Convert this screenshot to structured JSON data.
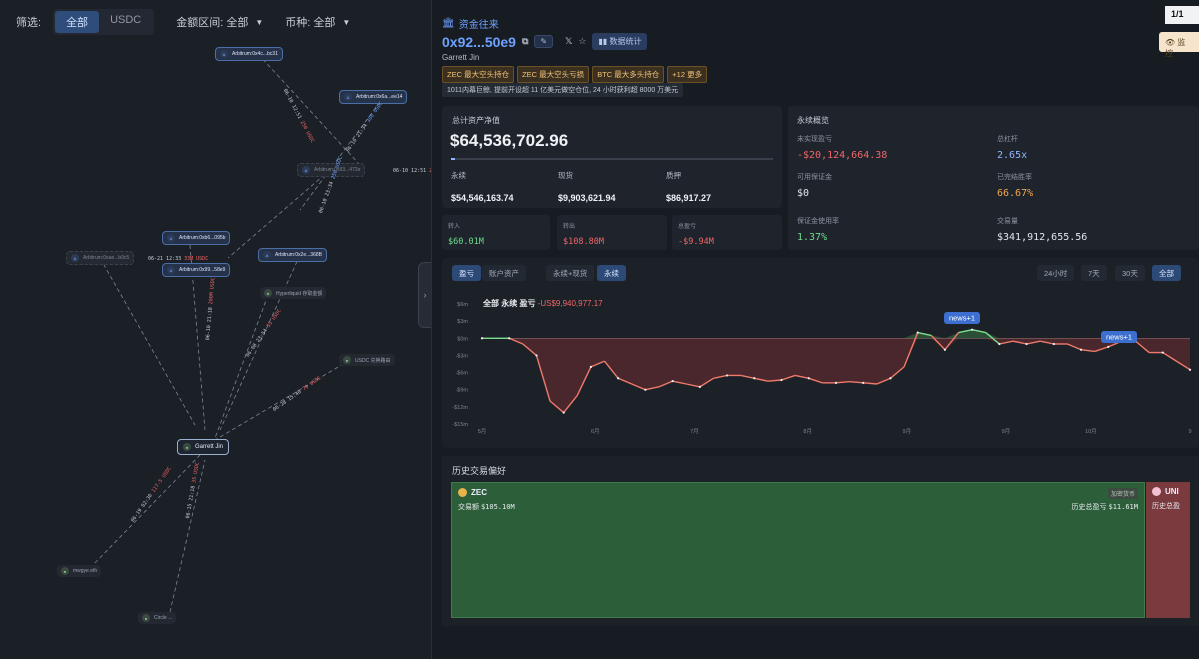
{
  "filters": {
    "label": "筛选:",
    "segments": [
      "全部",
      "USDC"
    ],
    "active_segment": "全部",
    "amount_label": "金额区间: 全部",
    "coin_label": "币种: 全部"
  },
  "graph": {
    "nodes": [
      {
        "id": "n1",
        "label": "Arbitrum:0x4c...bc31",
        "kind": "arb"
      },
      {
        "id": "n2",
        "label": "Arbitrum:0x6a...ee14",
        "kind": "arb"
      },
      {
        "id": "n3",
        "label": "Arbitrum:0x93...472e",
        "kind": "dim"
      },
      {
        "id": "n4",
        "label": "Arbitrum:0xb6...095b",
        "kind": "arb"
      },
      {
        "id": "n5",
        "label": "Arbitrum:0xae...b0c5",
        "kind": "dim"
      },
      {
        "id": "n6",
        "label": "Arbitrum:0x99...58e9",
        "kind": "arb"
      },
      {
        "id": "n7",
        "label": "Arbitrum:0x2e...368B",
        "kind": "arb"
      },
      {
        "id": "n8",
        "label": "Hyperliquid 存取金额",
        "kind": "plain"
      },
      {
        "id": "n9",
        "label": "USDC 兑换路由",
        "kind": "plain"
      },
      {
        "id": "n10",
        "label": "Garrett Jin",
        "kind": "center"
      },
      {
        "id": "n11",
        "label": "mwgye.eth",
        "kind": "plain"
      },
      {
        "id": "n12",
        "label": "Circle ...",
        "kind": "plain"
      }
    ],
    "edges": [
      {
        "date": "06-10 12:51",
        "amount": "250 USDC",
        "color": "#ef6767"
      },
      {
        "date": "06-10 21:34",
        "amount": "300 USDC",
        "color": "#6ea2ff"
      },
      {
        "date": "06-10 12:51",
        "amount": "250 USDC",
        "color": "#ef6767"
      },
      {
        "date": "06-10 23:34",
        "amount": "250 USDC",
        "color": "#6ea2ff"
      },
      {
        "date": "06-21 12:33",
        "amount": "33M USDC",
        "color": "#ef6767"
      },
      {
        "date": "06-10 21:18",
        "amount": "200M USDC",
        "color": "#ef6767"
      },
      {
        "date": "06-08 23:54",
        "amount": "35 USDC",
        "color": "#ef6767"
      },
      {
        "date": "06-28 15:40",
        "amount": "70 USDC",
        "color": "#ef6767"
      },
      {
        "date": "06-19 02:30",
        "amount": "117.5 USDC",
        "color": "#ef6767"
      },
      {
        "date": "06-15 21:18",
        "amount": "35 USDC",
        "color": "#ef6767"
      }
    ]
  },
  "header": {
    "section": "资金往来",
    "address": "0x92...50e9",
    "stats_button": "数据统计",
    "owner": "Garrett Jin",
    "tags": [
      "ZEC 最大空头持仓",
      "ZEC 最大空头亏损",
      "BTC 最大多头持仓",
      "+12 更多"
    ],
    "description": "1011内幕巨鲸, 提前开设超 11 亿美元做空仓位, 24 小时获利超 8000 万美元",
    "pager": "1/1",
    "monitor": "监控"
  },
  "networth": {
    "title": "总计资产净值",
    "value": "$64,536,702.96",
    "items": [
      {
        "label": "永续",
        "value": "$54,546,163.74"
      },
      {
        "label": "现货",
        "value": "$9,903,621.94"
      },
      {
        "label": "质押",
        "value": "$86,917.27"
      }
    ],
    "flows": [
      {
        "label": "转入",
        "value": "$60.01M",
        "tone": "green"
      },
      {
        "label": "转出",
        "value": "$108.80M",
        "tone": "red"
      },
      {
        "label": "总盈亏",
        "value": "-$9.94M",
        "tone": "red"
      }
    ]
  },
  "perp": {
    "title": "永续概览",
    "unrealized_label": "未实现盈亏",
    "unrealized": "-$20,124,664.38",
    "leverage_label": "总杠杆",
    "leverage": "2.65x",
    "margin_label": "可用保证金",
    "margin": "$0",
    "winrate_label": "已完结胜率",
    "winrate": "66.67%",
    "usage_label": "保证金使用率",
    "usage": "1.37%",
    "volume_label": "交易量",
    "volume": "$341,912,655.56"
  },
  "chart": {
    "tabs_left": [
      "盈亏",
      "账户资产"
    ],
    "tabs_mid": [
      "永续+现货",
      "永续"
    ],
    "tabs_range": [
      "24小时",
      "7天",
      "30天",
      "全部"
    ],
    "active": [
      "盈亏",
      "永续",
      "全部"
    ],
    "legend": "全部 永续 盈亏",
    "legend_value": "-US$9,940,977.17",
    "news": [
      "news+1",
      "news+1"
    ]
  },
  "chart_data": {
    "type": "area",
    "x_labels": [
      "5月",
      "6月",
      "7月",
      "8月",
      "9月",
      "9月",
      "10月",
      "9"
    ],
    "y_ticks": [
      "$6m",
      "$3m",
      "$0m",
      "-$3m",
      "-$6m",
      "-$9m",
      "-$12m",
      "-$15m"
    ],
    "ylim": [
      -15,
      6
    ],
    "values": [
      0,
      0,
      0,
      -1,
      -3,
      -11,
      -13,
      -10,
      -5,
      -4,
      -7,
      -8,
      -9,
      -8.5,
      -7.5,
      -8,
      -8.5,
      -7,
      -6.5,
      -6.5,
      -7,
      -7.5,
      -7.3,
      -6.5,
      -7,
      -7.8,
      -7.8,
      -7.6,
      -7.8,
      -8,
      -7,
      -5,
      1,
      0.5,
      -2,
      1,
      1.5,
      1,
      -1,
      -0.5,
      -1,
      -0.5,
      -1,
      -1,
      -2,
      -2.3,
      -1.5,
      -0.5,
      -0.5,
      -2.5,
      -2.5,
      -4,
      -5.5
    ],
    "unit": "M USD"
  },
  "history": {
    "title": "历史交易偏好",
    "items": [
      {
        "coin": "ZEC",
        "badge": "加密货币",
        "volume_label": "交易额",
        "volume": "$105.10M",
        "pnl_label": "历史总盈亏",
        "pnl": "$11.61M"
      },
      {
        "coin": "UNI",
        "pnl_label": "历史总盈"
      }
    ]
  }
}
